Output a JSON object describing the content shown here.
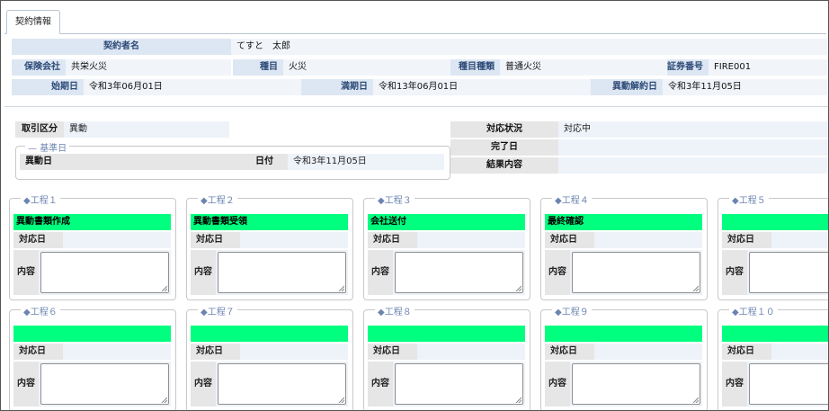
{
  "tab": {
    "label": "契約情報"
  },
  "contract": {
    "contractor_label": "契約者名",
    "contractor_value": "てすと　太郎",
    "insurer_label": "保険会社",
    "insurer_value": "共栄火災",
    "type_label": "種目",
    "type_value": "火災",
    "subtype_label": "種目種類",
    "subtype_value": "普通火災",
    "policy_label": "証券番号",
    "policy_value": "FIRE001",
    "start_label": "始期日",
    "start_value": "令和3年06月01日",
    "end_label": "満期日",
    "end_value": "令和13年06月01日",
    "change_cancel_label": "異動解約日",
    "change_cancel_value": "令和3年11月05日"
  },
  "transaction": {
    "category_label": "取引区分",
    "category_value": "異動",
    "base_date_legend": "基準日",
    "change_date_label": "異動日",
    "date_label": "日付",
    "date_value": "令和3年11月05日",
    "status_label": "対応状況",
    "status_value": "対応中",
    "completion_label": "完了日",
    "completion_value": "",
    "result_label": "結果内容",
    "result_value": ""
  },
  "process_labels": {
    "date": "対応日",
    "content": "内容"
  },
  "processes": [
    {
      "legend": "◆工程１",
      "title": "異動書類作成"
    },
    {
      "legend": "◆工程２",
      "title": "異動書類受領"
    },
    {
      "legend": "◆工程３",
      "title": "会社送付"
    },
    {
      "legend": "◆工程４",
      "title": "最終確認"
    },
    {
      "legend": "◆工程５",
      "title": ""
    },
    {
      "legend": "◆工程６",
      "title": ""
    },
    {
      "legend": "◆工程７",
      "title": ""
    },
    {
      "legend": "◆工程８",
      "title": ""
    },
    {
      "legend": "◆工程９",
      "title": ""
    },
    {
      "legend": "◆工程１０",
      "title": ""
    }
  ],
  "colors": {
    "process_title_bg": "#00ff7f",
    "label_bg": "#dde7f3",
    "label_text": "#2d4a77",
    "legend_text": "#6b84b0"
  }
}
